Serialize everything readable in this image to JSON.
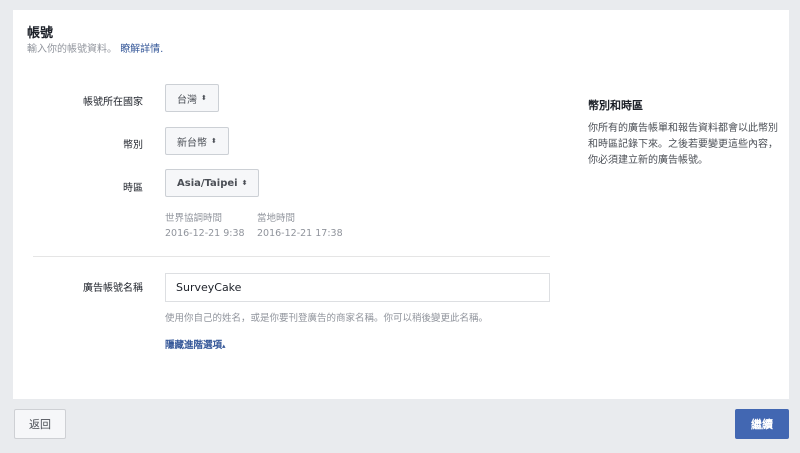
{
  "header": {
    "title": "帳號",
    "subtitle": "輸入你的帳號資料。",
    "learn_more": "瞭解詳情."
  },
  "form": {
    "country": {
      "label": "帳號所在國家",
      "value": "台灣"
    },
    "currency": {
      "label": "幣別",
      "value": "新台幣"
    },
    "timezone": {
      "label": "時區",
      "value": "Asia/Taipei",
      "utc_label": "世界協調時間",
      "utc_value": "2016-12-21 9:38",
      "local_label": "當地時間",
      "local_value": "2016-12-21 17:38"
    },
    "account_name": {
      "label": "廣告帳號名稱",
      "value": "SurveyCake",
      "hint": "使用你自己的姓名，或是你要刊登廣告的商家名稱。你可以稍後變更此名稱。"
    },
    "advanced_link": "隱藏進階選項",
    "advanced_icon": "caret-up-icon"
  },
  "sidebar": {
    "title": "幣別和時區",
    "body": "你所有的廣告帳單和報告資料都會以此幣別和時區記錄下來。之後若要變更這些內容，你必須建立新的廣告帳號。"
  },
  "footer": {
    "back": "返回",
    "next": "繼續"
  },
  "colors": {
    "accent": "#4267b2",
    "link": "#365899",
    "background": "#e9ebee"
  }
}
